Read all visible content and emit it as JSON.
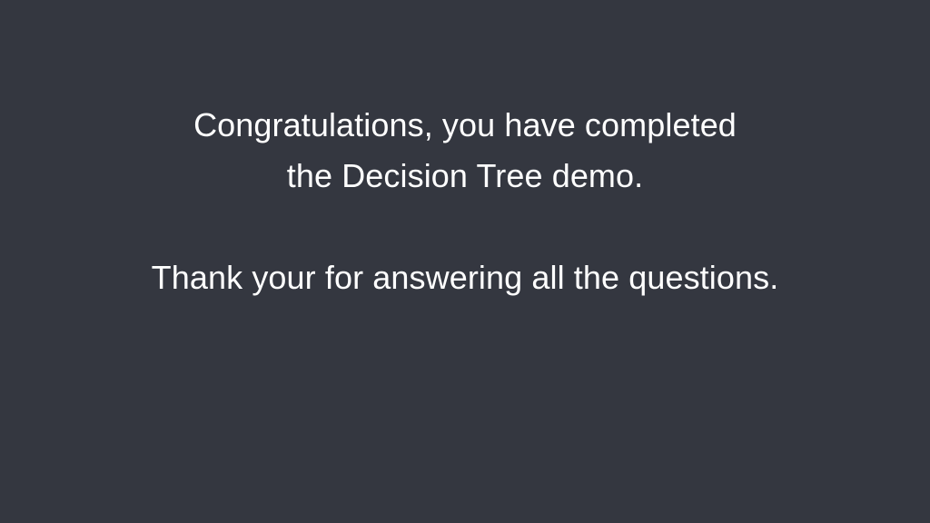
{
  "slide": {
    "background_color": "#343740",
    "text_color": "#ffffff",
    "completion_lines": [
      "Congratulations, you have completed",
      "the Decision Tree demo."
    ],
    "thanks_line": "Thank your for answering all the questions."
  }
}
